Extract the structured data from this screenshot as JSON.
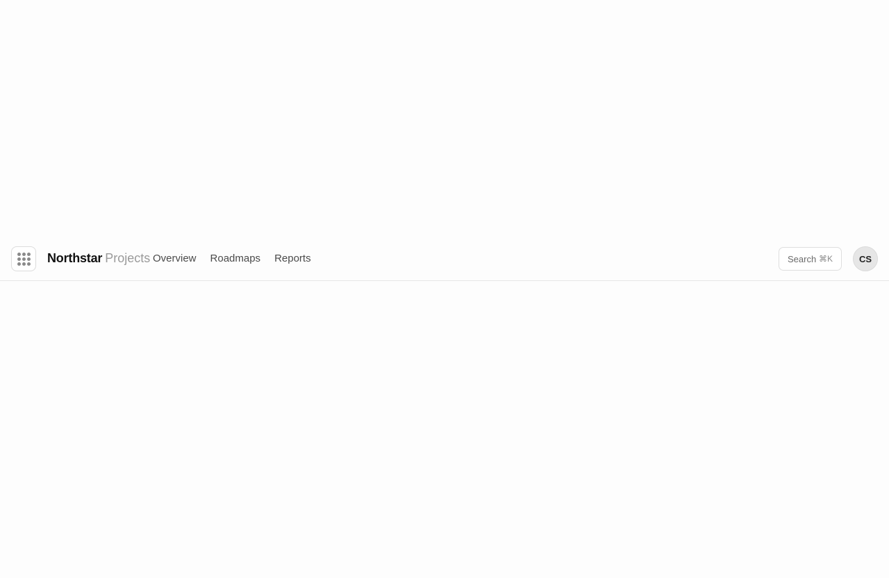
{
  "header": {
    "app_launcher_icon": "grid-icon",
    "brand": {
      "name": "Northstar",
      "suffix": "Projects"
    },
    "nav": [
      {
        "label": "Overview"
      },
      {
        "label": "Roadmaps"
      },
      {
        "label": "Reports"
      }
    ],
    "search": {
      "label": "Search",
      "shortcut": "⌘K"
    },
    "user": {
      "initials": "CS"
    }
  }
}
